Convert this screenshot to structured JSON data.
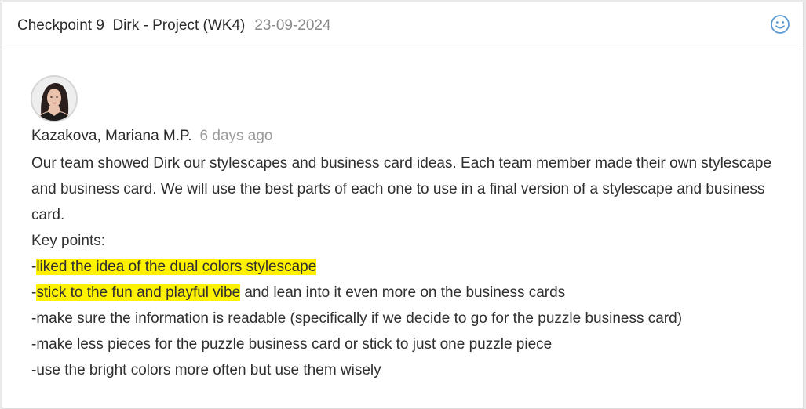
{
  "header": {
    "title": "Checkpoint 9  Dirk - Project (WK4)",
    "date": "23-09-2024",
    "reaction_icon": "smiley-icon"
  },
  "comment": {
    "author": "Kazakova, Mariana M.P.",
    "time_ago": "6 days ago",
    "avatar_icon": "user-avatar",
    "paragraph": "Our team showed Dirk our stylescapes and business card ideas. Each team member made their own stylescape and business card. We will use the best parts of each one to use in a final version of a stylescape and business card.",
    "key_points_label": "Key points:",
    "points": [
      {
        "prefix": "-",
        "highlight": "liked the idea of the dual colors stylescape ",
        "rest": ""
      },
      {
        "prefix": "-",
        "highlight": "stick to the fun and playful vibe",
        "rest": " and lean into it even more on the business cards"
      },
      {
        "prefix": "-",
        "highlight": "",
        "rest": "make sure the information is readable (specifically if we decide to go for the puzzle business card)"
      },
      {
        "prefix": "-",
        "highlight": "",
        "rest": "make less pieces for the puzzle business card or stick to just one puzzle piece"
      },
      {
        "prefix": "-",
        "highlight": "",
        "rest": "use the bright colors more often but use them wisely"
      }
    ]
  },
  "colors": {
    "highlight": "#fff200",
    "accent_icon": "#5b9bd5"
  }
}
